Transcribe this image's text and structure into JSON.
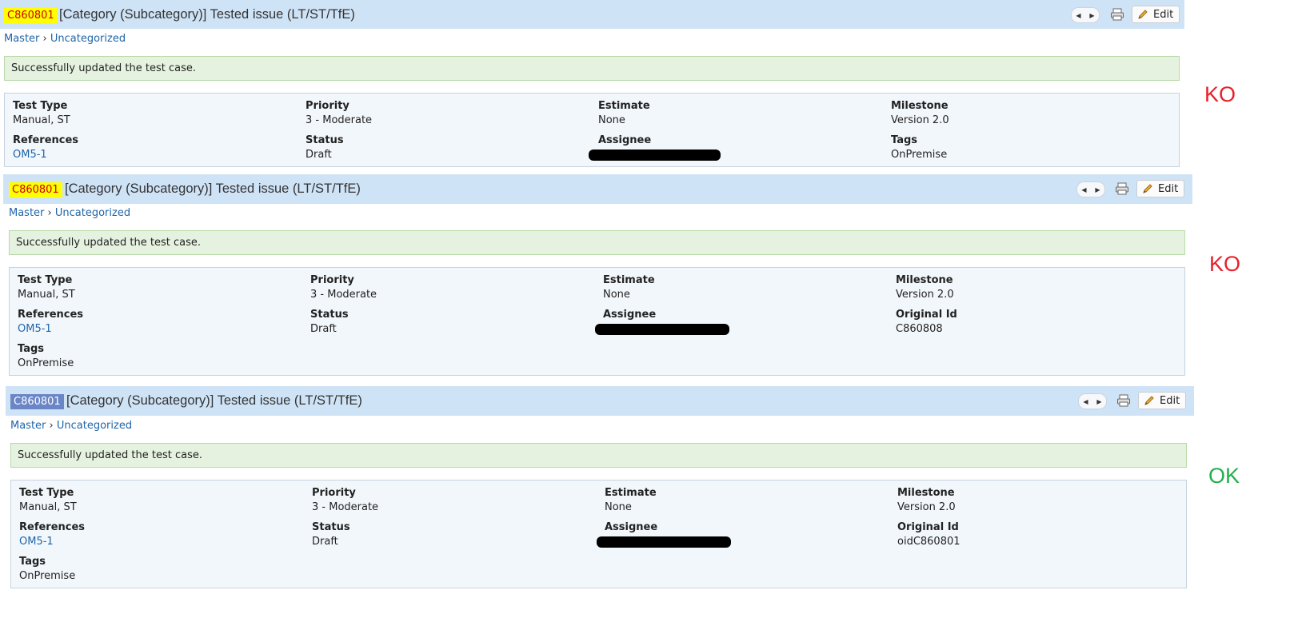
{
  "cases": [
    {
      "id": "C860801",
      "title": "[Category (Subcategory)] Tested issue (LT/ST/TfE)",
      "edit_label": "Edit",
      "breadcrumb": {
        "root": "Master",
        "sep": "›",
        "leaf": "Uncategorized"
      },
      "message": "Successfully updated the test case.",
      "fields": {
        "test_type": {
          "label": "Test Type",
          "value": "Manual, ST"
        },
        "priority": {
          "label": "Priority",
          "value": "3 - Moderate"
        },
        "estimate": {
          "label": "Estimate",
          "value": "None"
        },
        "milestone": {
          "label": "Milestone",
          "value": "Version 2.0"
        },
        "references": {
          "label": "References",
          "value": "OM5-1"
        },
        "status": {
          "label": "Status",
          "value": "Draft"
        },
        "assignee": {
          "label": "Assignee"
        },
        "tags": {
          "label": "Tags",
          "value": "OnPremise"
        }
      },
      "verdict": "KO"
    },
    {
      "id": "C860801",
      "title": "[Category (Subcategory)] Tested issue (LT/ST/TfE)",
      "edit_label": "Edit",
      "breadcrumb": {
        "root": "Master",
        "sep": "›",
        "leaf": "Uncategorized"
      },
      "message": "Successfully updated the test case.",
      "fields": {
        "test_type": {
          "label": "Test Type",
          "value": "Manual, ST"
        },
        "priority": {
          "label": "Priority",
          "value": "3 - Moderate"
        },
        "estimate": {
          "label": "Estimate",
          "value": "None"
        },
        "milestone": {
          "label": "Milestone",
          "value": "Version 2.0"
        },
        "references": {
          "label": "References",
          "value": "OM5-1"
        },
        "status": {
          "label": "Status",
          "value": "Draft"
        },
        "assignee": {
          "label": "Assignee"
        },
        "original_id": {
          "label": "Original Id",
          "value": "C860808"
        },
        "tags": {
          "label": "Tags",
          "value": "OnPremise"
        }
      },
      "verdict": "KO"
    },
    {
      "id": "C860801",
      "title": "[Category (Subcategory)] Tested issue (LT/ST/TfE)",
      "edit_label": "Edit",
      "breadcrumb": {
        "root": "Master",
        "sep": "›",
        "leaf": "Uncategorized"
      },
      "message": "Successfully updated the test case.",
      "fields": {
        "test_type": {
          "label": "Test Type",
          "value": "Manual, ST"
        },
        "priority": {
          "label": "Priority",
          "value": "3 - Moderate"
        },
        "estimate": {
          "label": "Estimate",
          "value": "None"
        },
        "milestone": {
          "label": "Milestone",
          "value": "Version 2.0"
        },
        "references": {
          "label": "References",
          "value": "OM5-1"
        },
        "status": {
          "label": "Status",
          "value": "Draft"
        },
        "assignee": {
          "label": "Assignee"
        },
        "original_id": {
          "label": "Original Id",
          "value": "oidC860801"
        },
        "tags": {
          "label": "Tags",
          "value": "OnPremise"
        }
      },
      "verdict": "OK"
    }
  ],
  "colors": {
    "ko": "#e8202a",
    "ok": "#22b04a",
    "id_highlight_yellow": "#ffff00",
    "id_highlight_blue": "#6b86c6"
  },
  "icons": [
    "chevron-left-icon",
    "chevron-right-icon",
    "printer-icon",
    "pencil-icon"
  ]
}
